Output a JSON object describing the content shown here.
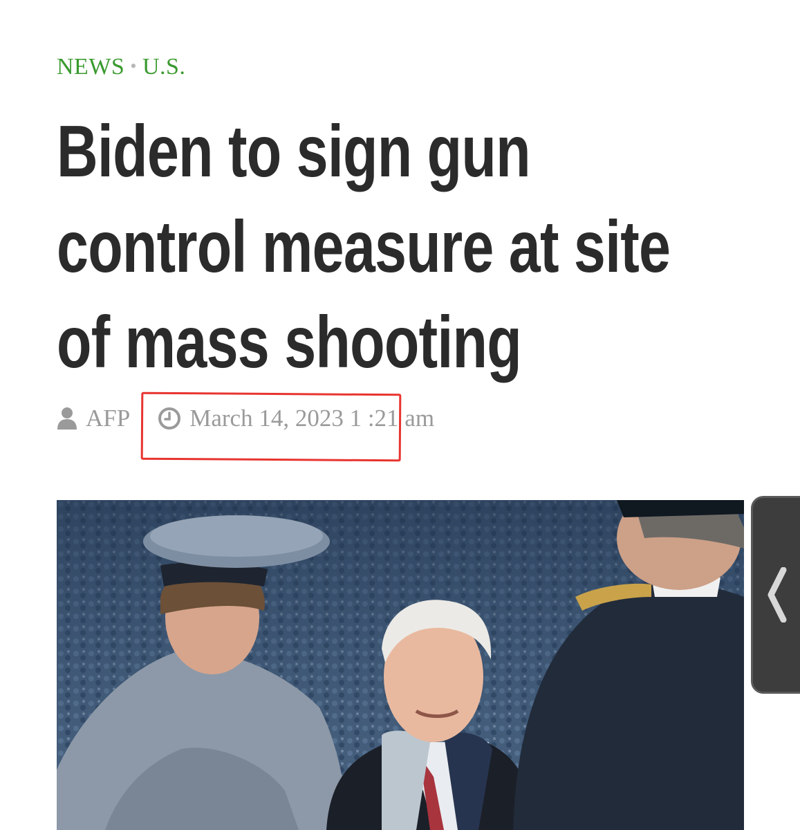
{
  "breadcrumb": {
    "section": "NEWS",
    "separator": "•",
    "subsection": "U.S."
  },
  "article": {
    "headline": "Biden to sign gun control measure at site of mass shooting",
    "author": "AFP",
    "timestamp": "March 14, 2023 1 :21 am",
    "image_description_icon": "photo"
  },
  "icons": {
    "author": "user-icon",
    "time": "clock-icon",
    "sidebar_toggle": "chevron-left-icon"
  },
  "colors": {
    "category": "#3a9a2f",
    "headline": "#2b2b2b",
    "meta": "#9a9a9a",
    "annotation": "#e8342f",
    "side_tab": "#3d3d3d"
  }
}
